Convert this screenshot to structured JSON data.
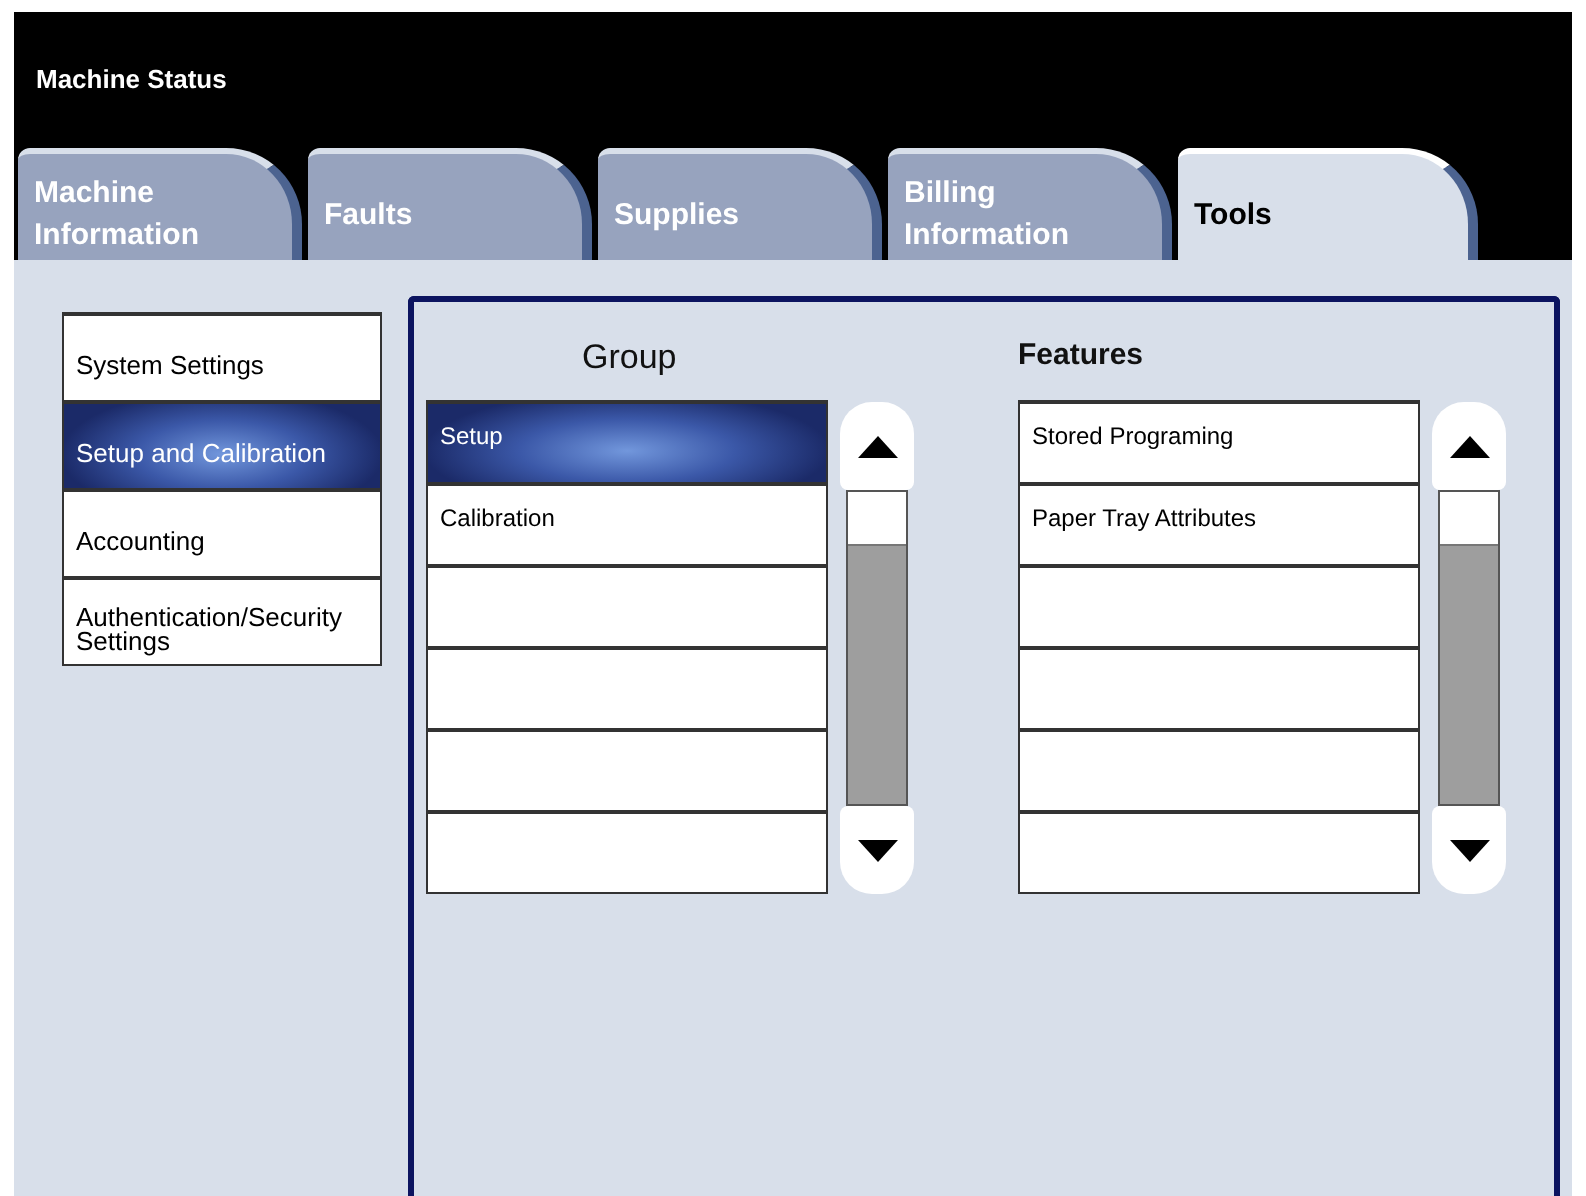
{
  "window": {
    "title": "Machine Status"
  },
  "tabs": [
    {
      "label": "Machine Information",
      "selected": false
    },
    {
      "label": "Faults",
      "selected": false
    },
    {
      "label": "Supplies",
      "selected": false
    },
    {
      "label": "Billing Information",
      "selected": false
    },
    {
      "label": "Tools",
      "selected": true
    }
  ],
  "categories": [
    {
      "label": "System Settings",
      "selected": false
    },
    {
      "label": "Setup and Calibration",
      "selected": true
    },
    {
      "label": "Accounting",
      "selected": false
    },
    {
      "label": "Authentication/Security Settings",
      "selected": false
    }
  ],
  "group": {
    "heading": "Group",
    "items": [
      {
        "label": "Setup",
        "selected": true
      },
      {
        "label": "Calibration",
        "selected": false
      }
    ]
  },
  "features": {
    "heading": "Features",
    "items": [
      {
        "label": "Stored Programing"
      },
      {
        "label": "Paper Tray Attributes"
      }
    ]
  }
}
